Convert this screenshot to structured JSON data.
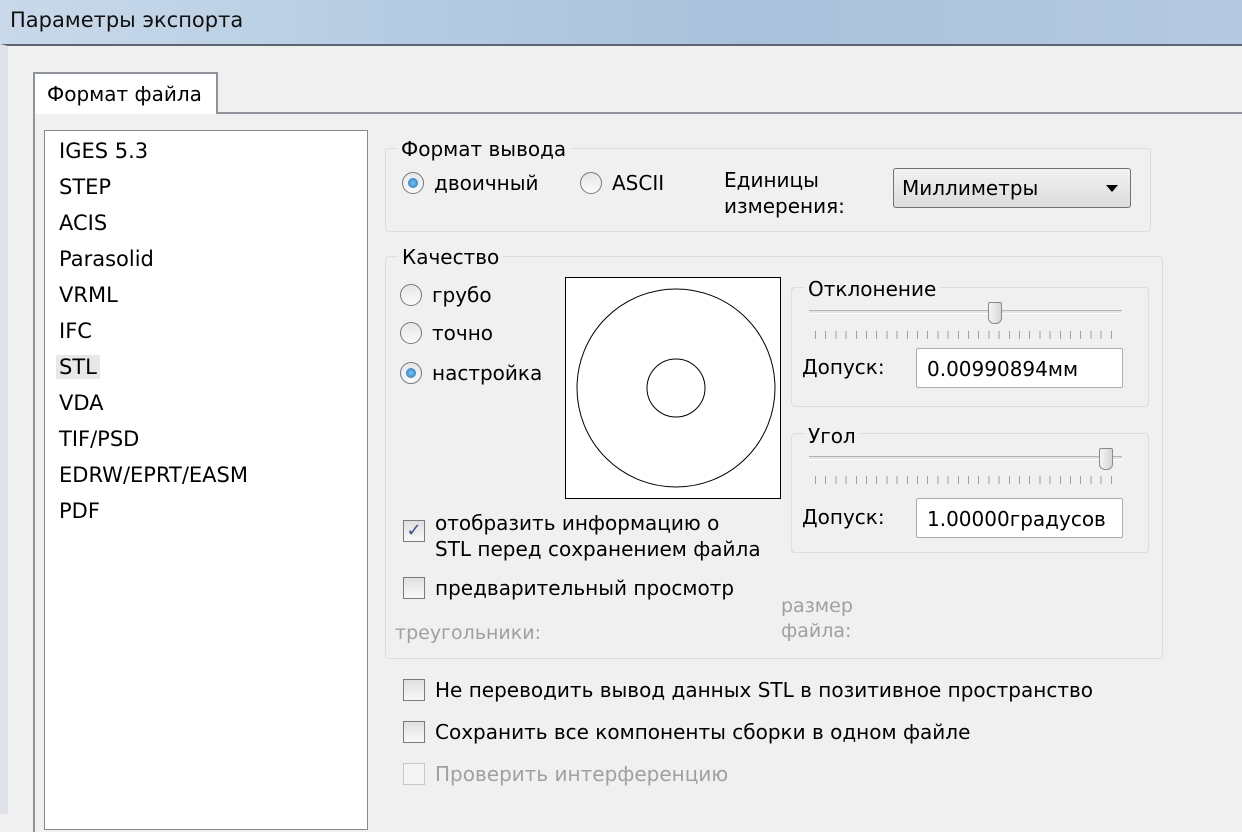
{
  "window": {
    "title": "Параметры экспорта"
  },
  "tabs": [
    {
      "label": "Формат файла",
      "active": true
    }
  ],
  "formats": [
    "IGES 5.3",
    "STEP",
    "ACIS",
    "Parasolid",
    "VRML",
    "IFC",
    "STL",
    "VDA",
    "TIF/PSD",
    "EDRW/EPRT/EASM",
    "PDF"
  ],
  "selected_format": "STL",
  "output": {
    "group_label": "Формат вывода",
    "binary_label": "двоичный",
    "ascii_label": "ASCII",
    "selected": "binary",
    "units_label_1": "Единицы",
    "units_label_2": "измерения:",
    "units_value": "Миллиметры"
  },
  "quality": {
    "group_label": "Качество",
    "coarse_label": "грубо",
    "fine_label": "точно",
    "custom_label": "настройка",
    "selected": "custom",
    "deviation": {
      "label": "Отклонение",
      "tolerance_label": "Допуск:",
      "value": "0.00990894мм",
      "slider_fraction": 0.6
    },
    "angle": {
      "label": "Угол",
      "tolerance_label": "Допуск:",
      "value": "1.00000градусов",
      "slider_fraction": 0.97
    },
    "show_info_line1": "отобразить информацию о",
    "show_info_line2": "STL перед сохранением файла",
    "show_info_checked": true,
    "preview_label": "предварительный просмотр",
    "preview_checked": false,
    "triangles_label": "треугольники:",
    "filesize_line1": "размер",
    "filesize_line2": "файла:"
  },
  "options": [
    {
      "label": "Не переводить вывод данных STL в позитивное пространство",
      "checked": false,
      "enabled": true
    },
    {
      "label": "Сохранить все компоненты сборки в одном файле",
      "checked": false,
      "enabled": true
    },
    {
      "label": "Проверить интерференцию",
      "checked": false,
      "enabled": false
    }
  ]
}
